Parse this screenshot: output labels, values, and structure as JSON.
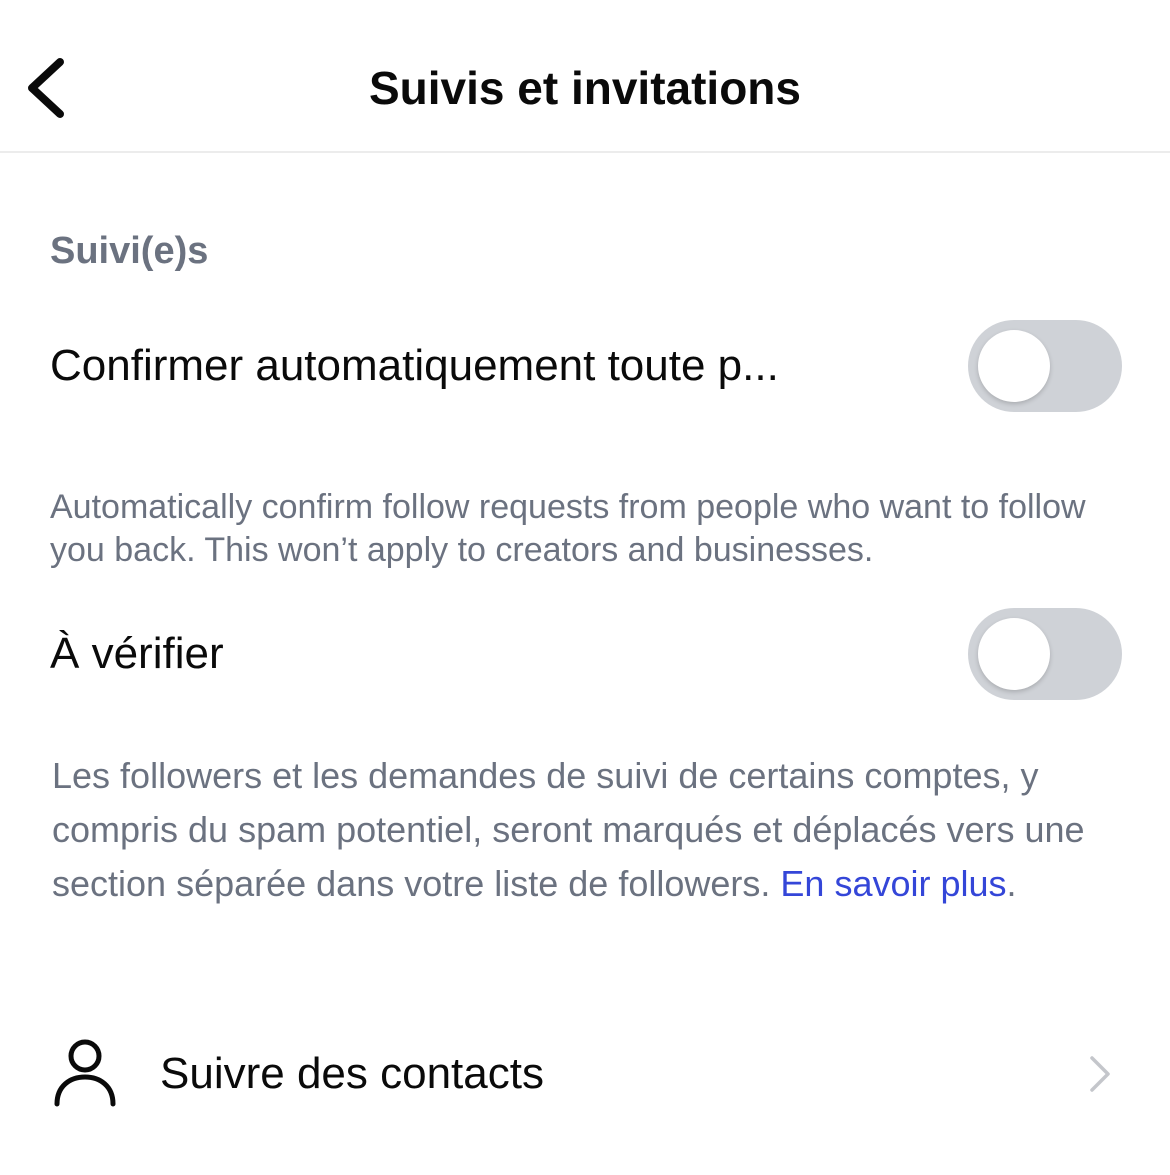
{
  "header": {
    "title": "Suivis et invitations",
    "back_icon": "chevron-left-icon"
  },
  "section": {
    "title": "Suivi(e)s"
  },
  "settings": [
    {
      "label": "Confirmer automatiquement toute p...",
      "enabled": false,
      "description": "Automatically confirm follow requests from people who want to follow you back. This won’t apply to creators and businesses."
    },
    {
      "label": "À vérifier",
      "enabled": false,
      "description": "Les followers et les demandes de suivi de certains comptes, y compris du spam potentiel, seront marqués et déplacés vers une section séparée dans votre liste de followers.",
      "link_text": "En savoir plus",
      "trailing": "."
    }
  ],
  "contacts": {
    "label": "Suivre des contacts",
    "icon": "person-icon",
    "chevron": "chevron-right-icon"
  },
  "colors": {
    "toggle_off": "#cfd2d7",
    "secondary_text": "#6b7280",
    "link": "#3446d8"
  }
}
